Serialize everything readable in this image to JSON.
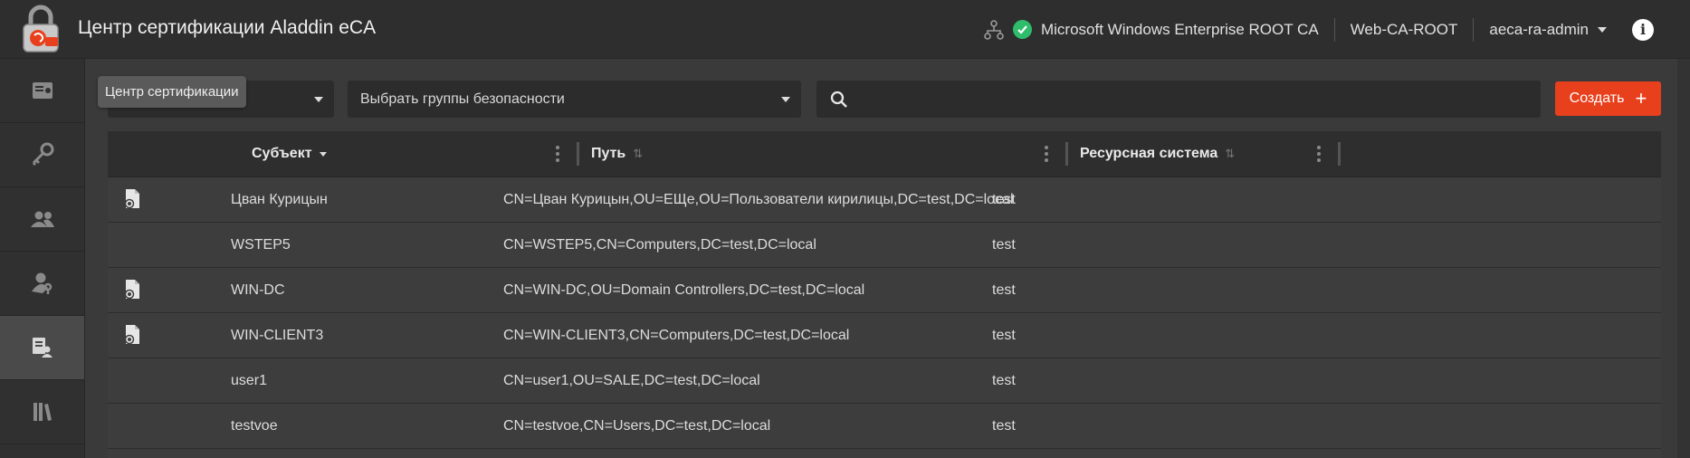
{
  "header": {
    "app_title": "Центр сертификации Aladdin eCA",
    "ca_name": "Microsoft Windows Enterprise ROOT CA",
    "ca_short": "Web-CA-ROOT",
    "user": "aeca-ra-admin",
    "info_label": "i"
  },
  "sidebar": {
    "items": [
      {
        "icon": "certificate-icon"
      },
      {
        "icon": "keys-icon"
      },
      {
        "icon": "users-icon"
      },
      {
        "icon": "user-key-icon"
      },
      {
        "icon": "subjects-icon",
        "active": true
      },
      {
        "icon": "library-icon"
      }
    ]
  },
  "toolbar": {
    "tooltip": "Центр сертификации",
    "groups_placeholder": "Выбрать группы безопасности",
    "search_value": "",
    "create_label": "Создать",
    "create_plus": "+"
  },
  "table": {
    "columns": {
      "subject": "Субъект",
      "path": "Путь",
      "resource_system": "Ресурсная система"
    },
    "rows": [
      {
        "has_cert": true,
        "subject": "Цван Курицын",
        "path": "CN=Цван Курицын,OU=ЕЩе,OU=Пользователи кирилицы,DC=test,DC=local",
        "resource_system": "test"
      },
      {
        "has_cert": false,
        "subject": "WSTEP5",
        "path": "CN=WSTEP5,CN=Computers,DC=test,DC=local",
        "resource_system": "test"
      },
      {
        "has_cert": true,
        "subject": "WIN-DC",
        "path": "CN=WIN-DC,OU=Domain Controllers,DC=test,DC=local",
        "resource_system": "test"
      },
      {
        "has_cert": true,
        "subject": "WIN-CLIENT3",
        "path": "CN=WIN-CLIENT3,CN=Computers,DC=test,DC=local",
        "resource_system": "test"
      },
      {
        "has_cert": false,
        "subject": "user1",
        "path": "CN=user1,OU=SALE,DC=test,DC=local",
        "resource_system": "test"
      },
      {
        "has_cert": false,
        "subject": "testvoe",
        "path": "CN=testvoe,CN=Users,DC=test,DC=local",
        "resource_system": "test"
      }
    ]
  },
  "colors": {
    "accent": "#e8401c",
    "status_ok": "#2fbd6b"
  }
}
